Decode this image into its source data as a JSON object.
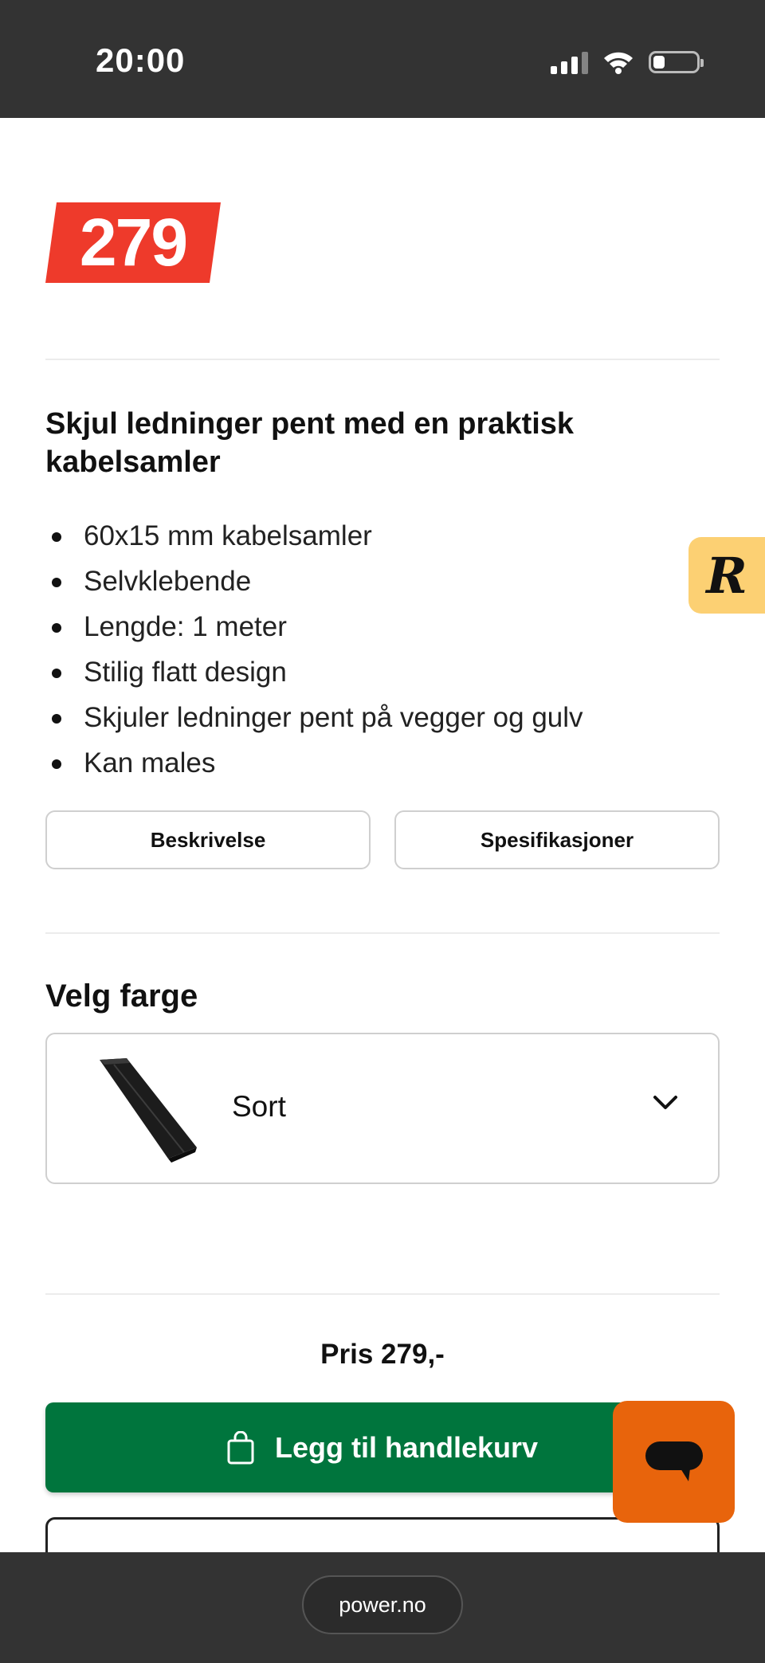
{
  "status_bar": {
    "time": "20:00"
  },
  "product": {
    "price_badge": "279",
    "headline": "Skjul ledninger pent med en praktisk kabelsamler",
    "features": [
      "60x15 mm kabelsamler",
      "Selvklebende",
      "Lengde: 1 meter",
      "Stilig flatt design",
      "Skjuler ledninger pent på vegger og gulv",
      "Kan males"
    ],
    "tabs": {
      "description": "Beskrivelse",
      "specifications": "Spesifikasjoner"
    }
  },
  "color_picker": {
    "title": "Velg farge",
    "selected": "Sort"
  },
  "purchase": {
    "price_text": "Pris 279,-",
    "add_to_cart": "Legg til handlekurv"
  },
  "browser": {
    "url": "power.no"
  },
  "widgets": {
    "review_badge": "R"
  },
  "colors": {
    "price_badge": "#ee3a2b",
    "primary_button": "#00753d",
    "chat_fab": "#e8640c",
    "review_badge": "#fcd073",
    "status_bar": "#333333"
  },
  "icons": [
    "signal-icon",
    "wifi-icon",
    "battery-icon",
    "chevron-down-icon",
    "shopping-bag-icon",
    "chat-icon"
  ]
}
